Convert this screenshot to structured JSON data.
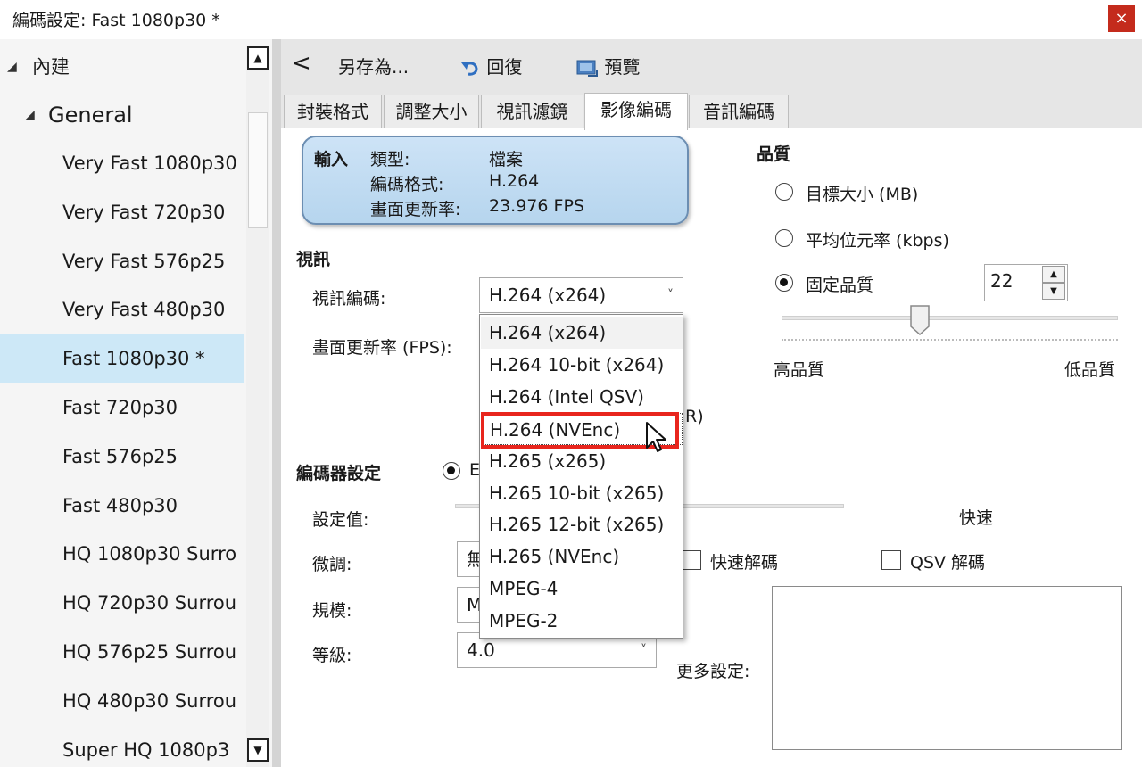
{
  "window": {
    "title": "編碼設定: Fast 1080p30 *",
    "close_glyph": "×"
  },
  "sidebar": {
    "groups": [
      {
        "label": "內建"
      },
      {
        "label": "General"
      }
    ],
    "items": [
      {
        "label": "Very Fast 1080p30"
      },
      {
        "label": "Very Fast 720p30"
      },
      {
        "label": "Very Fast 576p25"
      },
      {
        "label": "Very Fast 480p30"
      },
      {
        "label": "Fast 1080p30 *"
      },
      {
        "label": "Fast 720p30"
      },
      {
        "label": "Fast 576p25"
      },
      {
        "label": "Fast 480p30"
      },
      {
        "label": "HQ 1080p30 Surro"
      },
      {
        "label": "HQ 720p30 Surrou"
      },
      {
        "label": "HQ 576p25 Surrou"
      },
      {
        "label": "HQ 480p30 Surrou"
      },
      {
        "label": "Super HQ 1080p3"
      }
    ],
    "selected_index": 4
  },
  "toolbar": {
    "back_glyph": "<",
    "save_as": "另存為...",
    "revert": "回復",
    "preview": "預覽"
  },
  "tabs": [
    "封裝格式",
    "調整大小",
    "視訊濾鏡",
    "影像編碼",
    "音訊編碼"
  ],
  "active_tab": 3,
  "input_box": {
    "title": "輸入",
    "type_label": "類型:",
    "type_value": "檔案",
    "codec_label": "編碼格式:",
    "codec_value": "H.264",
    "fps_label": "畫面更新率:",
    "fps_value": "23.976 FPS"
  },
  "video": {
    "section": "視訊",
    "codec_label": "視訊編碼:",
    "codec_value": "H.264 (x264)",
    "fps_label": "畫面更新率 (FPS):",
    "partial_text": "R)"
  },
  "dropdown": {
    "options": [
      "H.264 (x264)",
      "H.264 10-bit (x264)",
      "H.264 (Intel QSV)",
      "H.264 (NVEnc)",
      "H.265 (x265)",
      "H.265 10-bit (x265)",
      "H.265 12-bit (x265)",
      "H.265 (NVEnc)",
      "MPEG-4",
      "MPEG-2"
    ],
    "current_index": 0,
    "hover_index": 3
  },
  "quality": {
    "section": "品質",
    "options": [
      "目標大小 (MB)",
      "平均位元率 (kbps)",
      "固定品質"
    ],
    "selected_index": 2,
    "value": "22",
    "high_label": "高品質",
    "low_label": "低品質",
    "slider_fraction": 0.41
  },
  "encoder": {
    "section": "編碼器設定",
    "radio_partial": "E",
    "preset_label": "設定值:",
    "preset_right": "快速",
    "tune_label": "微調:",
    "tune_partial": "無",
    "profile_label": "規模:",
    "profile_partial": "M",
    "level_label": "等級:",
    "level_value": "4.0",
    "fast_decode": "快速解碼",
    "qsv_decode": "QSV 解碼",
    "more_settings": "更多設定:"
  },
  "colors": {
    "accent_selection": "#cde8f7",
    "highlight_box": "#e8251d",
    "close_button": "#c42b1c"
  },
  "icons": [
    "close-icon",
    "back-icon",
    "undo-icon",
    "preview-icon",
    "collapse-triangle-icon",
    "chevron-down-icon",
    "cursor-icon"
  ]
}
